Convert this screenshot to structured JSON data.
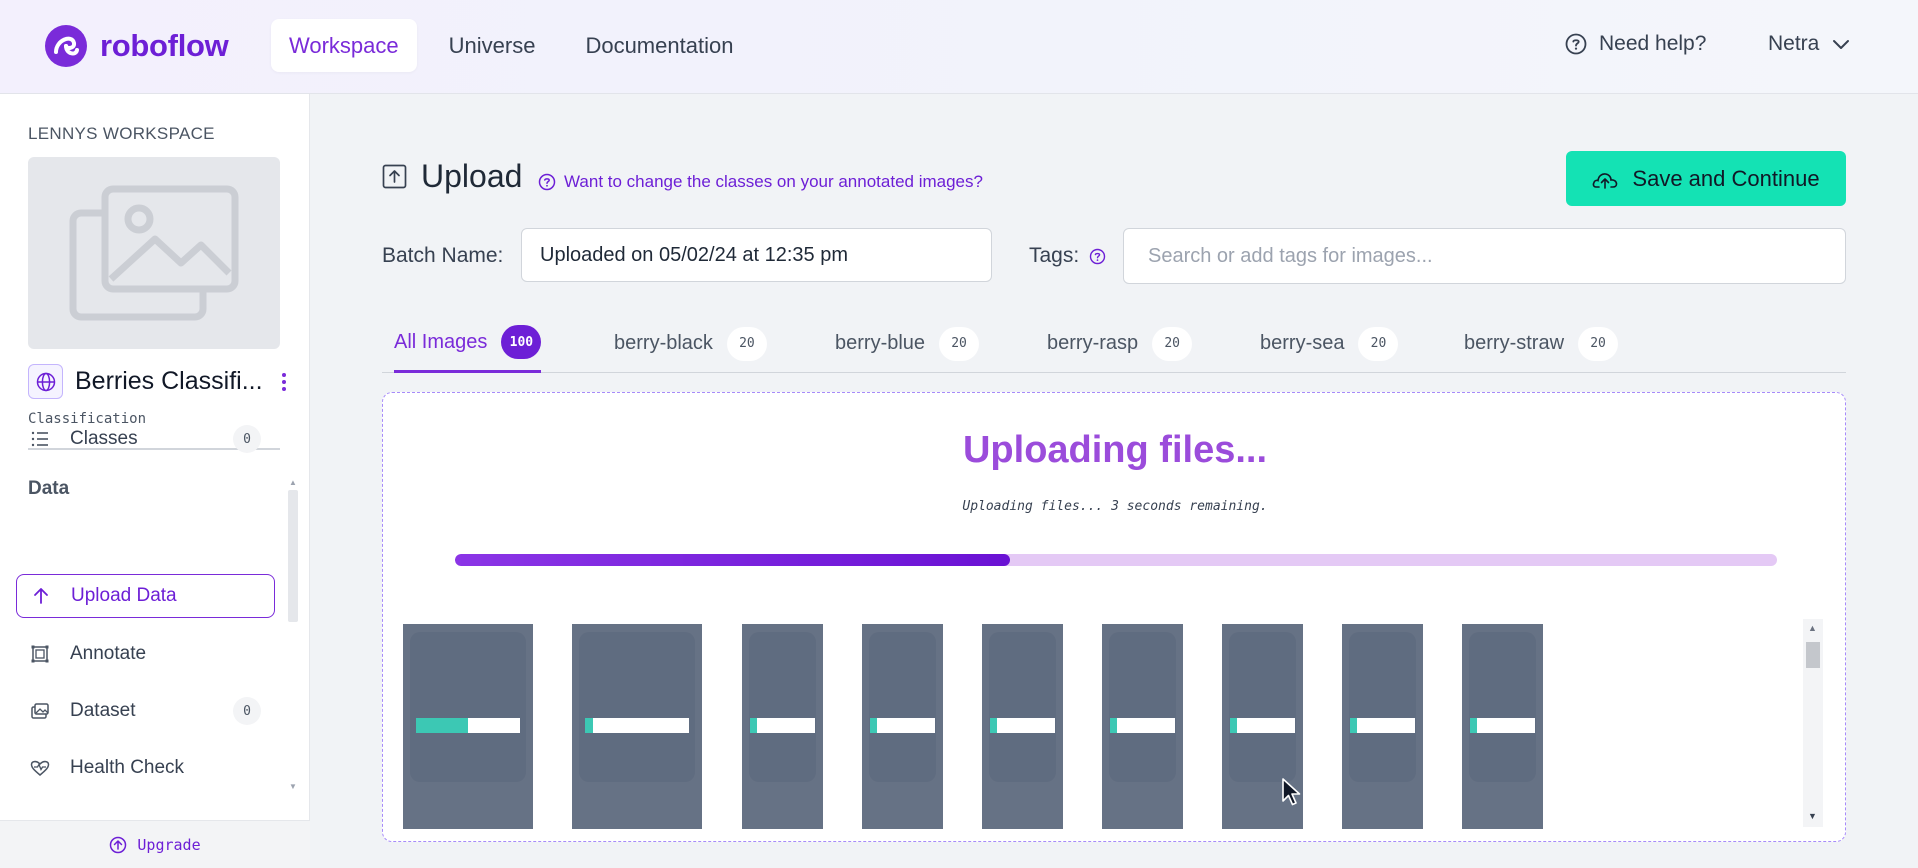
{
  "brand": {
    "name": "roboflow",
    "color": "#6d1fd6",
    "icon": "roboflow-logo-icon"
  },
  "topnav": {
    "items": [
      {
        "label": "Workspace",
        "active": true
      },
      {
        "label": "Universe",
        "active": false
      },
      {
        "label": "Documentation",
        "active": false
      }
    ],
    "help_label": "Need help?",
    "user_name": "Netra"
  },
  "sidebar": {
    "workspace_title": "LENNYS WORKSPACE",
    "project": {
      "name": "Berries Classifi...",
      "type": "Classification"
    },
    "section_label": "Data",
    "items": [
      {
        "label": "Classes",
        "icon": "list-icon",
        "count": "0",
        "active": false
      },
      {
        "label": "Upload Data",
        "icon": "arrow-up-icon",
        "count": "",
        "active": true
      },
      {
        "label": "Annotate",
        "icon": "annotate-icon",
        "count": "",
        "active": false
      },
      {
        "label": "Dataset",
        "icon": "images-icon",
        "count": "0",
        "active": false
      },
      {
        "label": "Health Check",
        "icon": "heart-pulse-icon",
        "count": "",
        "active": false
      }
    ],
    "upgrade_label": "Upgrade"
  },
  "upload": {
    "title": "Upload",
    "class_hint": "Want to change the classes on your annotated images?",
    "save_button": "Save and Continue",
    "batch_label": "Batch Name:",
    "batch_value": "Uploaded on 05/02/24 at 12:35 pm",
    "tags_label": "Tags:",
    "tags_placeholder": "Search or add tags for images..."
  },
  "tabs": [
    {
      "label": "All Images",
      "count": "100",
      "active": true
    },
    {
      "label": "berry-black",
      "count": "20",
      "active": false
    },
    {
      "label": "berry-blue",
      "count": "20",
      "active": false
    },
    {
      "label": "berry-rasp",
      "count": "20",
      "active": false
    },
    {
      "label": "berry-sea",
      "count": "20",
      "active": false
    },
    {
      "label": "berry-straw",
      "count": "20",
      "active": false
    }
  ],
  "progress": {
    "title": "Uploading files...",
    "subtitle": "Uploading files... 3 seconds remaining.",
    "overall_fraction": 0.42
  },
  "thumbnails": [
    {
      "progress": 0.5
    },
    {
      "progress": 0.08
    },
    {
      "progress": 0.1
    },
    {
      "progress": 0.1
    },
    {
      "progress": 0.1
    },
    {
      "progress": 0.1
    },
    {
      "progress": 0.1
    },
    {
      "progress": 0.1
    },
    {
      "progress": 0.1
    }
  ],
  "colors": {
    "accent": "#7a2bd9",
    "save_button_bg": "#14e2b4",
    "progress_fill": "#6a12d4",
    "progress_track": "#e4c9f5",
    "thumb_progress": "#3cc8b4"
  }
}
